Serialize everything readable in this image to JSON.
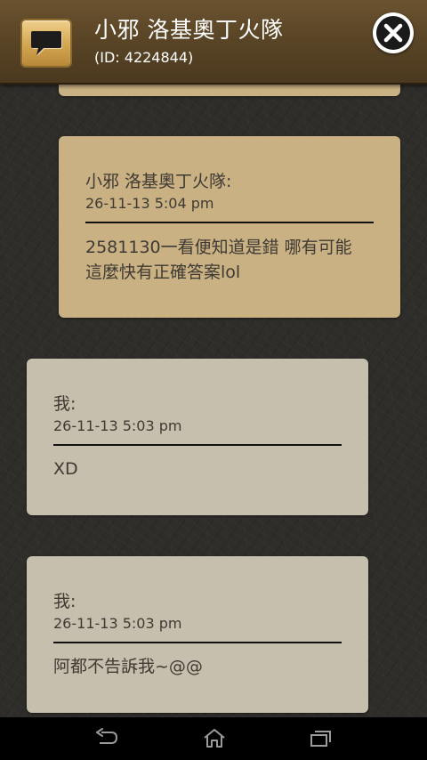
{
  "header": {
    "title": "小邪 洛基奧丁火隊",
    "subtitle": "(ID: 4224844)",
    "icon": "chat-bubble-icon",
    "close_icon": "close-icon"
  },
  "messages": [
    {
      "from": "them",
      "sender": "小邪 洛基奧丁火隊:",
      "time": "26-11-13 5:04 pm",
      "text": "2581130一看便知道是錯 哪有可能這麼快有正確答案lol"
    },
    {
      "from": "me",
      "sender": "我:",
      "time": "26-11-13 5:03 pm",
      "text": "XD"
    },
    {
      "from": "me",
      "sender": "我:",
      "time": "26-11-13 5:03 pm",
      "text": "阿都不告訴我~@@"
    }
  ],
  "navbar": {
    "buttons": [
      "back-icon",
      "home-icon",
      "recent-apps-icon"
    ]
  },
  "colors": {
    "header": "#5a4526",
    "their_bubble": "#c9b184",
    "my_bubble": "#c6bfad",
    "background": "#2e2d2a"
  }
}
